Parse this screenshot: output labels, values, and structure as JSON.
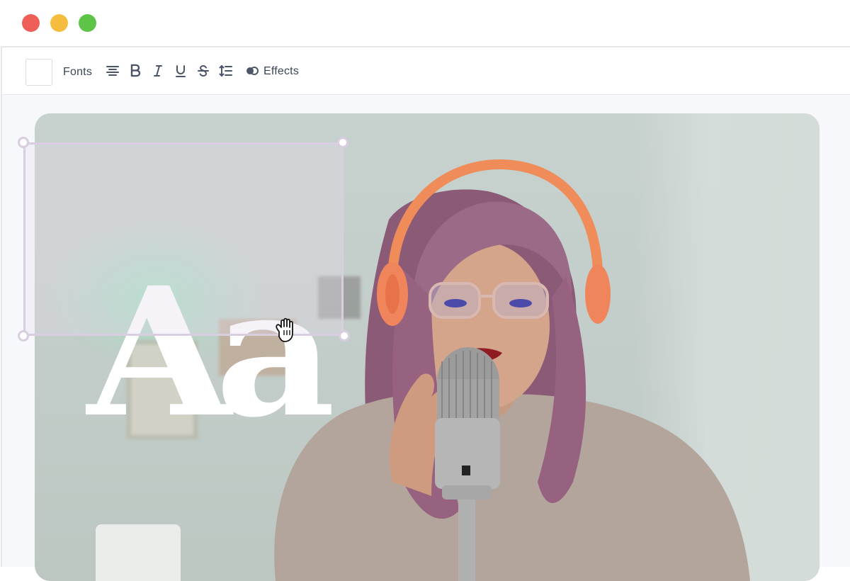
{
  "window": {
    "controls": [
      {
        "name": "close",
        "color": "#ef5f57"
      },
      {
        "name": "minimize",
        "color": "#f5bd40"
      },
      {
        "name": "maximize",
        "color": "#5ec447"
      }
    ]
  },
  "toolbar": {
    "color_swatch": "#ffffff",
    "fonts_label": "Fonts",
    "icons": [
      "align-center-icon",
      "bold-icon",
      "italic-icon",
      "underline-icon",
      "strikethrough-icon",
      "line-spacing-icon",
      "effects-icon"
    ],
    "effects_label": "Effects"
  },
  "canvas": {
    "text_element": "Aa",
    "cursor": "grab-hand-icon",
    "selection_color": "#d9cde0"
  }
}
